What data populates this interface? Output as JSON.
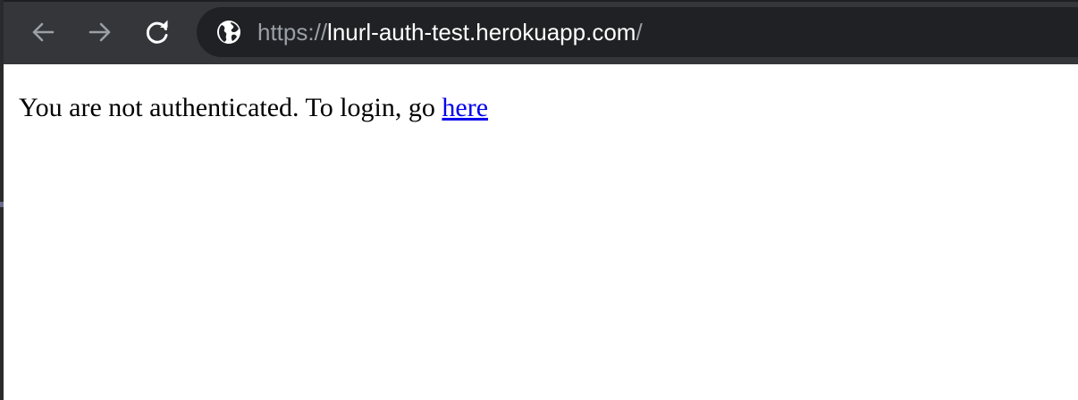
{
  "browser": {
    "toolbar": {
      "back_icon": "arrow-left-icon",
      "forward_icon": "arrow-right-icon",
      "reload_icon": "reload-icon"
    },
    "omnibox": {
      "site_info_icon": "globe-icon",
      "url_scheme": "https://",
      "url_host": "lnurl-auth-test.herokuapp.com",
      "url_path": "/"
    },
    "colors": {
      "toolbar_bg": "#35363a",
      "omnibox_bg": "#202124",
      "icon": "#9aa0a6",
      "url_host": "#ffffff"
    }
  },
  "page": {
    "message_text": "You are not authenticated. To login, go ",
    "link_text": "here",
    "link_color": "#0000ee"
  }
}
